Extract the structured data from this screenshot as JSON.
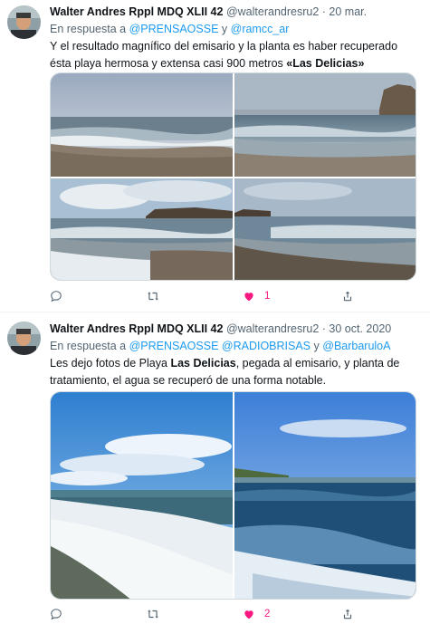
{
  "tweets": [
    {
      "name": "Walter Andres Rppl MDQ XLII 42",
      "handle": "@walterandresru2",
      "separator": "·",
      "time": "20 mar.",
      "reply_prefix": "En respuesta a",
      "mentions": [
        "@PRENSAOSSE",
        "@ramcc_ar"
      ],
      "mention_joiner": "y",
      "text_before": "Y el resultado magnífico del emisario y la planta es haber recuperado ésta playa hermosa y extensa casi 900 metros ",
      "text_bold": "«Las Delicias»",
      "text_after": "",
      "like_count": "1",
      "liked": true
    },
    {
      "name": "Walter Andres Rppl MDQ XLII 42",
      "handle": "@walterandresru2",
      "separator": "·",
      "time": "30 oct. 2020",
      "reply_prefix": "En respuesta a",
      "mentions": [
        "@PRENSAOSSE",
        "@RADIOBRISAS",
        "@BarbaruloA"
      ],
      "mention_joiner": "y",
      "text_before": "Les dejo fotos de Playa ",
      "text_bold": "Las Delicias",
      "text_after": ", pegada al emisario, y planta de tratamiento, el agua se recuperó de una forma notable.",
      "like_count": "2",
      "liked": true
    }
  ],
  "icons": {
    "reply": "reply-icon",
    "retweet": "retweet-icon",
    "like": "heart-icon",
    "share": "share-icon"
  },
  "colors": {
    "link": "#1d9bf0",
    "like": "#f91880",
    "muted": "#536471",
    "text": "#0f1419"
  }
}
